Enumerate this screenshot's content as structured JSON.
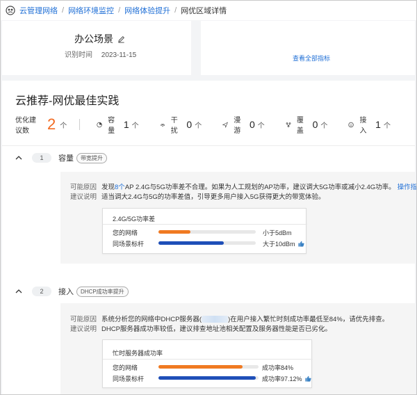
{
  "breadcrumb": {
    "items": [
      "云管理网络",
      "网络环境监控",
      "网络体验提升"
    ],
    "current": "网优区域详情"
  },
  "scene": {
    "name": "办公场景",
    "identified_label": "识别时间",
    "identified_date": "2023-11-15"
  },
  "metrics_link": "查看全部指标",
  "main": {
    "title": "云推荐-网优最佳实践",
    "total_label": "优化建议数",
    "total_value": "2",
    "unit": "个",
    "stats": [
      {
        "icon": "capacity-icon",
        "label": "容量",
        "value": "1",
        "unit": "个"
      },
      {
        "icon": "interference-icon",
        "label": "干扰",
        "value": "0",
        "unit": "个"
      },
      {
        "icon": "roaming-icon",
        "label": "漫游",
        "value": "0",
        "unit": "个"
      },
      {
        "icon": "coverage-icon",
        "label": "覆盖",
        "value": "0",
        "unit": "个"
      },
      {
        "icon": "access-icon",
        "label": "接入",
        "value": "1",
        "unit": "个"
      }
    ]
  },
  "items": [
    {
      "index": "1",
      "category": "容量",
      "tag": "带宽提升",
      "reason_label": "可能原因",
      "reason_pre": "发现",
      "reason_count": "8个",
      "reason_post": "AP 2.4G与5G功率差不合理。如果为人工规划的AP功率，建议调大5G功率或减小2.4G功率。",
      "reason_link": "操作指导",
      "advice_label": "建议说明",
      "advice": "适当调大2.4G与5G的功率差值，引导更多用户接入5G获得更大的带宽体验。",
      "metric": {
        "title": "2.4G/5G功率差",
        "rows": [
          {
            "label": "您的网络",
            "value": "小于5dBm",
            "fill": 0.33,
            "color": "#f07a22",
            "thumb": false
          },
          {
            "label": "同场景标杆",
            "value": "大于10dBm",
            "fill": 0.67,
            "color": "#1f4fb8",
            "thumb": true
          }
        ]
      }
    },
    {
      "index": "2",
      "category": "接入",
      "tag": "DHCP成功率提升",
      "reason_label": "可能原因",
      "reason_pre": "系统分析您的网络中DHCP服务器(",
      "reason_post": ")在用户接入繁忙时刻成功率最低至84%，请优先排查。",
      "advice_label": "建议说明",
      "advice": "DHCP服务器成功率较低，建议排查地址池相关配置及服务器性能是否已劣化。",
      "metric": {
        "title": "忙时服务器成功率",
        "rows": [
          {
            "label": "您的网络",
            "value": "成功率84%",
            "fill": 0.84,
            "color": "#f07a22",
            "thumb": false
          },
          {
            "label": "同场景标杆",
            "value": "成功率97.12%",
            "fill": 0.97,
            "color": "#1f4fb8",
            "thumb": true
          }
        ]
      }
    }
  ]
}
